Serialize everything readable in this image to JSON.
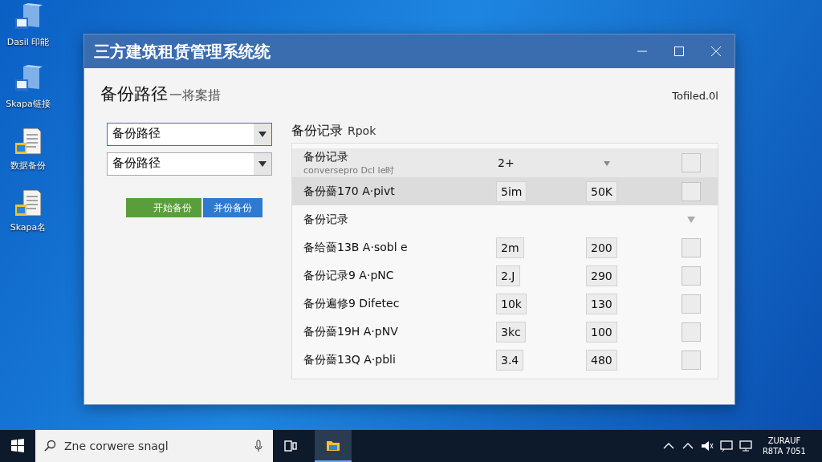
{
  "desktop_icons": [
    {
      "label": "Dasil 印能",
      "kind": "monitor"
    },
    {
      "label": "Skapa链接",
      "kind": "monitor"
    },
    {
      "label": "数据备份",
      "kind": "document"
    },
    {
      "label": "Skapa名",
      "kind": "document"
    }
  ],
  "window": {
    "title": "三方建筑租赁管理系统统"
  },
  "heading": "备份路径",
  "heading_note": "一将案措",
  "version": "Tofiled.0l",
  "dropdowns": [
    {
      "value": "备份路径",
      "focused": true
    },
    {
      "value": "备份路径",
      "focused": false
    }
  ],
  "buttons": [
    {
      "label": "开始备份",
      "kind": "green"
    },
    {
      "label": "并份备份",
      "kind": "blue"
    }
  ],
  "records": {
    "title": "备份记录",
    "title_note": "Rpok",
    "header": {
      "name": "备份记录",
      "subtitle": "conversepro Dcl le时",
      "column_2": "2+",
      "checked": false
    },
    "rows": [
      {
        "kind": "row",
        "name": "备份薔170 A·pivt",
        "column_2": "5im",
        "column_3": "50K",
        "selected": true,
        "checked": false
      },
      {
        "kind": "group",
        "name": "备份记录",
        "expanded": true
      },
      {
        "kind": "row",
        "name": "备给薔13B A·sobl e",
        "column_2": "2m",
        "column_3": "200",
        "selected": false,
        "checked": false
      },
      {
        "kind": "row",
        "name": "备份记录9 A·pNC",
        "column_2": "2.J",
        "column_3": "290",
        "selected": false,
        "checked": false
      },
      {
        "kind": "row",
        "name": "备份遍修9 Difetec",
        "column_2": "10k",
        "column_3": "130",
        "selected": false,
        "checked": false
      },
      {
        "kind": "row",
        "name": "备份薔19H A·pNV",
        "column_2": "3kc",
        "column_3": "100",
        "selected": false,
        "checked": false
      },
      {
        "kind": "row",
        "name": "备份薔13Q A·pbli",
        "column_2": "3.4",
        "column_3": "480",
        "selected": false,
        "checked": false
      }
    ]
  },
  "taskbar": {
    "search_placeholder": "Zne corwere snagl",
    "clock": [
      "ZURAUF",
      "R8TA 7051"
    ]
  }
}
